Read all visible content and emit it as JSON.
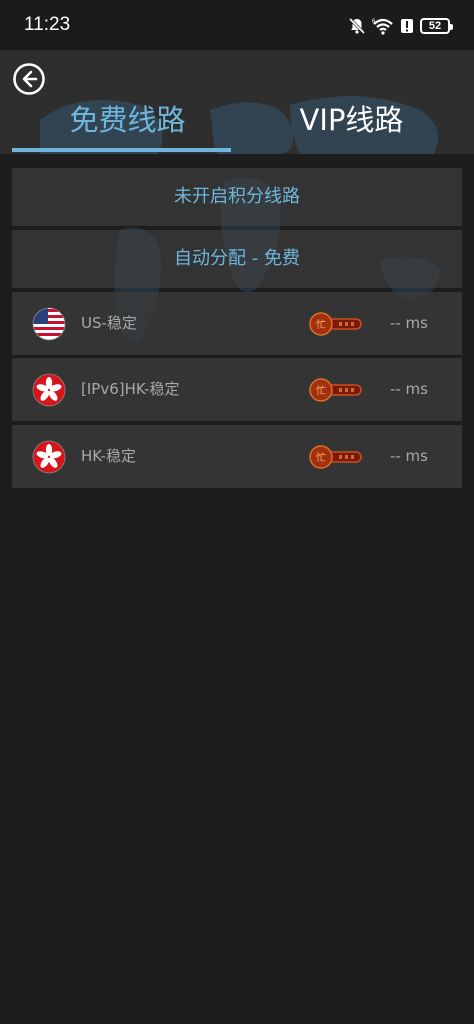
{
  "status_bar": {
    "time": "11:23",
    "battery": "52",
    "icons": [
      "mute-icon",
      "wifi-icon",
      "alert-icon",
      "battery-icon"
    ]
  },
  "header": {
    "tabs": [
      {
        "label": "免费线路",
        "active": true
      },
      {
        "label": "VIP线路",
        "active": false
      }
    ],
    "accent_color": "#6fb6dd"
  },
  "options": [
    {
      "label": "未开启积分线路"
    },
    {
      "label": "自动分配 - 免费"
    }
  ],
  "servers": [
    {
      "name": "US-稳定",
      "flag": "us-flag-icon",
      "latency": "-- ms"
    },
    {
      "name": "[IPv6]HK-稳定",
      "flag": "hk-flag-icon",
      "latency": "-- ms"
    },
    {
      "name": "HK-稳定",
      "flag": "hk-flag-icon",
      "latency": "-- ms"
    }
  ]
}
